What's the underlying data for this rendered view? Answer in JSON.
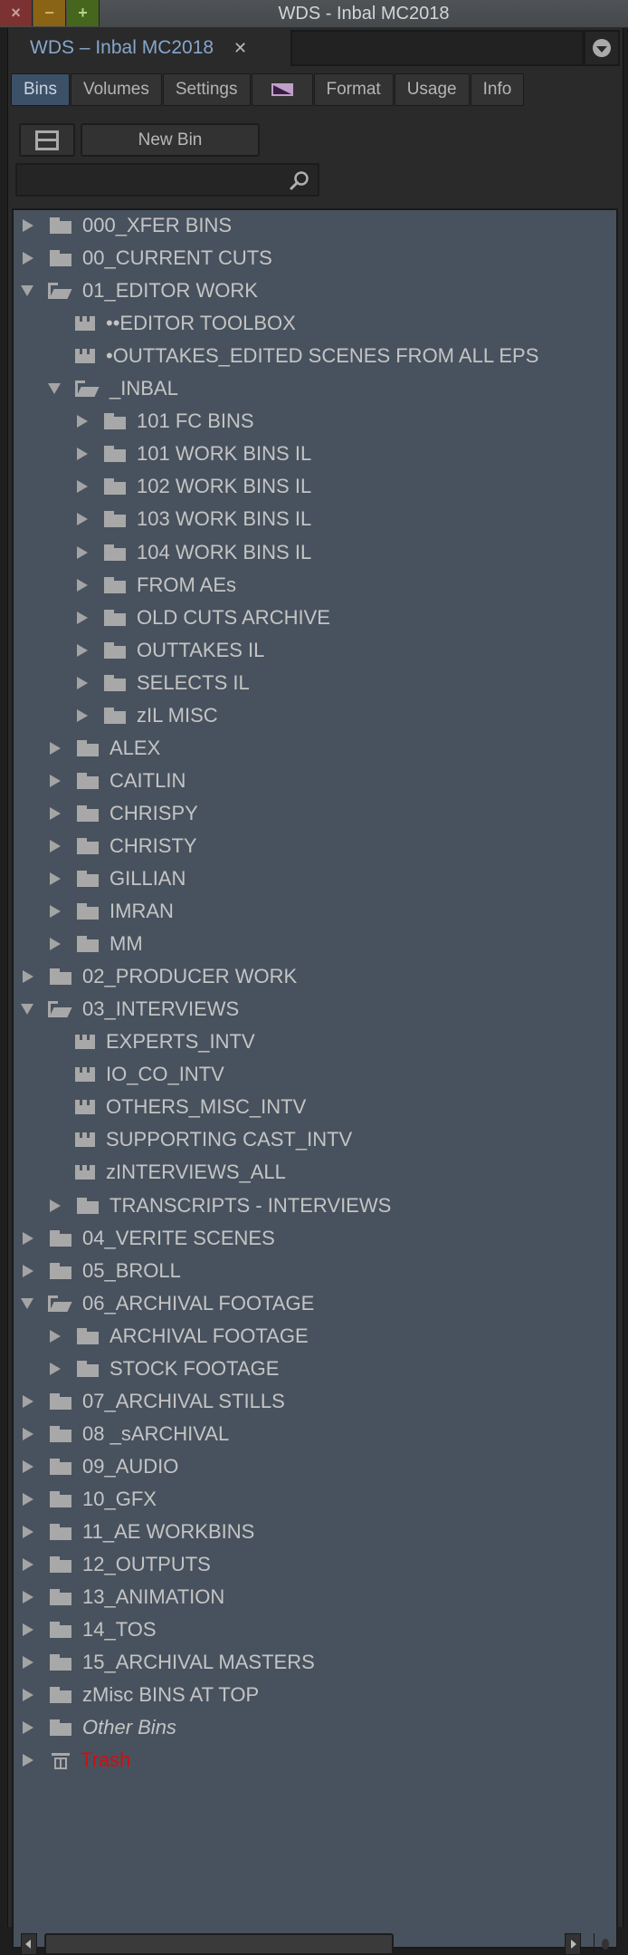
{
  "window": {
    "title": "WDS - Inbal MC2018",
    "close_label": "×",
    "minimize_label": "−",
    "maximize_label": "+"
  },
  "doc_tab": {
    "label": "WDS – Inbal MC2018",
    "close_label": "✕"
  },
  "subtabs": [
    {
      "label": "Bins",
      "active": true
    },
    {
      "label": "Volumes"
    },
    {
      "label": "Settings"
    },
    {
      "label": "",
      "icon": "swatch-icon"
    },
    {
      "label": "Format"
    },
    {
      "label": "Usage"
    },
    {
      "label": "Info"
    }
  ],
  "toolbar": {
    "new_bin_label": "New Bin"
  },
  "search": {
    "value": "",
    "placeholder": ""
  },
  "colors": {
    "tree_bg": "#48525e",
    "active_tab": "#3c5068",
    "trash_text": "#cc1010",
    "doc_tab_text": "#86a6cc"
  },
  "tree": [
    {
      "label": "000_XFER BINS",
      "depth": 0,
      "type": "folder",
      "state": "collapsed"
    },
    {
      "label": "00_CURRENT CUTS",
      "depth": 0,
      "type": "folder",
      "state": "collapsed"
    },
    {
      "label": "01_EDITOR WORK",
      "depth": 0,
      "type": "folder",
      "state": "expanded"
    },
    {
      "label": "••EDITOR TOOLBOX",
      "depth": 1,
      "type": "bin"
    },
    {
      "label": "•OUTTAKES_EDITED SCENES FROM ALL EPS",
      "depth": 1,
      "type": "bin"
    },
    {
      "label": "_INBAL",
      "depth": 1,
      "type": "folder",
      "state": "expanded"
    },
    {
      "label": "101 FC BINS",
      "depth": 2,
      "type": "folder",
      "state": "collapsed"
    },
    {
      "label": "101 WORK BINS IL",
      "depth": 2,
      "type": "folder",
      "state": "collapsed"
    },
    {
      "label": "102 WORK BINS IL",
      "depth": 2,
      "type": "folder",
      "state": "collapsed"
    },
    {
      "label": "103 WORK BINS IL",
      "depth": 2,
      "type": "folder",
      "state": "collapsed"
    },
    {
      "label": "104 WORK BINS IL",
      "depth": 2,
      "type": "folder",
      "state": "collapsed"
    },
    {
      "label": "FROM AEs",
      "depth": 2,
      "type": "folder",
      "state": "collapsed"
    },
    {
      "label": "OLD CUTS ARCHIVE",
      "depth": 2,
      "type": "folder",
      "state": "collapsed"
    },
    {
      "label": "OUTTAKES IL",
      "depth": 2,
      "type": "folder",
      "state": "collapsed"
    },
    {
      "label": "SELECTS IL",
      "depth": 2,
      "type": "folder",
      "state": "collapsed"
    },
    {
      "label": "zIL MISC",
      "depth": 2,
      "type": "folder",
      "state": "collapsed"
    },
    {
      "label": "ALEX",
      "depth": 1,
      "type": "folder",
      "state": "collapsed"
    },
    {
      "label": "CAITLIN",
      "depth": 1,
      "type": "folder",
      "state": "collapsed"
    },
    {
      "label": "CHRISPY",
      "depth": 1,
      "type": "folder",
      "state": "collapsed"
    },
    {
      "label": "CHRISTY",
      "depth": 1,
      "type": "folder",
      "state": "collapsed"
    },
    {
      "label": "GILLIAN",
      "depth": 1,
      "type": "folder",
      "state": "collapsed"
    },
    {
      "label": "IMRAN",
      "depth": 1,
      "type": "folder",
      "state": "collapsed"
    },
    {
      "label": "MM",
      "depth": 1,
      "type": "folder",
      "state": "collapsed"
    },
    {
      "label": "02_PRODUCER WORK",
      "depth": 0,
      "type": "folder",
      "state": "collapsed"
    },
    {
      "label": "03_INTERVIEWS",
      "depth": 0,
      "type": "folder",
      "state": "expanded"
    },
    {
      "label": "EXPERTS_INTV",
      "depth": 1,
      "type": "bin"
    },
    {
      "label": "IO_CO_INTV",
      "depth": 1,
      "type": "bin"
    },
    {
      "label": "OTHERS_MISC_INTV",
      "depth": 1,
      "type": "bin"
    },
    {
      "label": "SUPPORTING CAST_INTV",
      "depth": 1,
      "type": "bin"
    },
    {
      "label": "zINTERVIEWS_ALL",
      "depth": 1,
      "type": "bin"
    },
    {
      "label": "TRANSCRIPTS - INTERVIEWS",
      "depth": 1,
      "type": "folder",
      "state": "collapsed"
    },
    {
      "label": "04_VERITE SCENES",
      "depth": 0,
      "type": "folder",
      "state": "collapsed"
    },
    {
      "label": "05_BROLL",
      "depth": 0,
      "type": "folder",
      "state": "collapsed"
    },
    {
      "label": "06_ARCHIVAL FOOTAGE",
      "depth": 0,
      "type": "folder",
      "state": "expanded"
    },
    {
      "label": "ARCHIVAL FOOTAGE",
      "depth": 1,
      "type": "folder",
      "state": "collapsed"
    },
    {
      "label": "STOCK FOOTAGE",
      "depth": 1,
      "type": "folder",
      "state": "collapsed"
    },
    {
      "label": "07_ARCHIVAL STILLS",
      "depth": 0,
      "type": "folder",
      "state": "collapsed"
    },
    {
      "label": "08 _sARCHIVAL",
      "depth": 0,
      "type": "folder",
      "state": "collapsed"
    },
    {
      "label": "09_AUDIO",
      "depth": 0,
      "type": "folder",
      "state": "collapsed"
    },
    {
      "label": "10_GFX",
      "depth": 0,
      "type": "folder",
      "state": "collapsed"
    },
    {
      "label": "11_AE WORKBINS",
      "depth": 0,
      "type": "folder",
      "state": "collapsed"
    },
    {
      "label": "12_OUTPUTS",
      "depth": 0,
      "type": "folder",
      "state": "collapsed"
    },
    {
      "label": "13_ANIMATION",
      "depth": 0,
      "type": "folder",
      "state": "collapsed"
    },
    {
      "label": "14_TOS",
      "depth": 0,
      "type": "folder",
      "state": "collapsed"
    },
    {
      "label": "15_ARCHIVAL MASTERS",
      "depth": 0,
      "type": "folder",
      "state": "collapsed"
    },
    {
      "label": "zMisc BINS AT TOP",
      "depth": 0,
      "type": "folder",
      "state": "collapsed"
    },
    {
      "label": "Other Bins",
      "depth": 0,
      "type": "folder",
      "state": "collapsed",
      "style": "italic"
    },
    {
      "label": "Trash",
      "depth": 0,
      "type": "trash",
      "state": "collapsed"
    }
  ]
}
